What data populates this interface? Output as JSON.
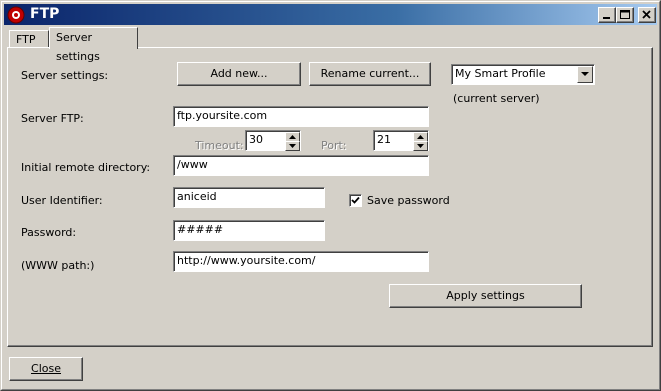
{
  "window": {
    "title": "FTP"
  },
  "tabs": [
    {
      "label": "FTP"
    },
    {
      "label": "Server settings"
    }
  ],
  "server_settings": {
    "label": "Server settings:",
    "add_new_label": "Add new...",
    "rename_label": "Rename current...",
    "profile_selected": "My Smart Profile",
    "current_server_note": "(current server)"
  },
  "server_ftp": {
    "label": "Server FTP:",
    "value": "ftp.yoursite.com"
  },
  "timeout": {
    "label": "Timeout:",
    "value": "30"
  },
  "port": {
    "label": "Port:",
    "value": "21"
  },
  "remote_dir": {
    "label": "Initial remote directory:",
    "value": "/www"
  },
  "user": {
    "label": "User Identifier:",
    "value": "aniceid"
  },
  "save_password": {
    "label": "Save password",
    "checked": true
  },
  "password": {
    "label": "Password:",
    "value": "#####"
  },
  "www_path": {
    "label": "(WWW path:)",
    "value": "http://www.yoursite.com/"
  },
  "apply_label": "Apply settings",
  "close_label": "Close"
}
